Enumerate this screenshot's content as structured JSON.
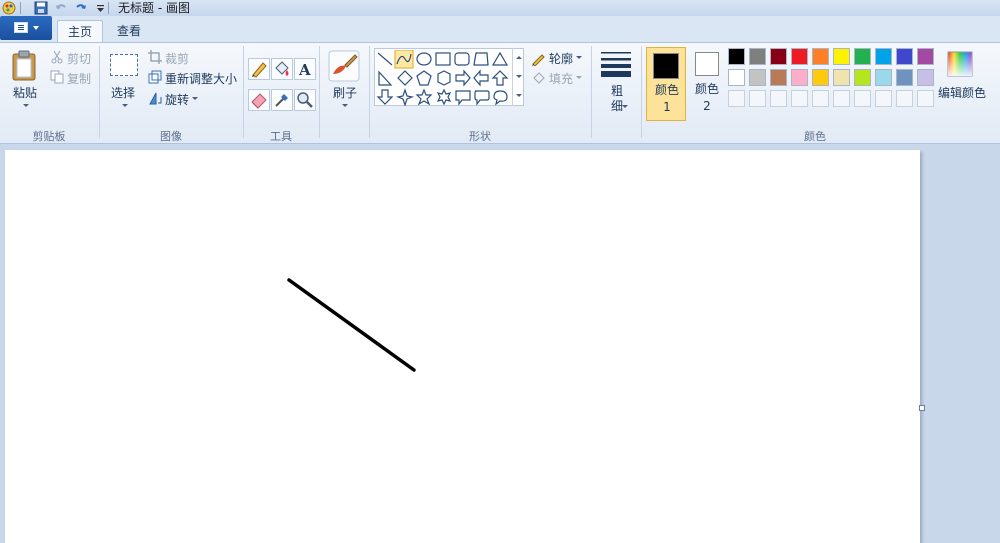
{
  "window": {
    "title": "无标题 - 画图"
  },
  "tabs": [
    {
      "label": "主页",
      "active": true
    },
    {
      "label": "查看",
      "active": false
    }
  ],
  "groups": {
    "clipboard": {
      "label": "剪贴板",
      "paste": "粘贴",
      "cut": "剪切",
      "copy": "复制"
    },
    "image": {
      "label": "图像",
      "select": "选择",
      "crop": "裁剪",
      "resize": "重新调整大小",
      "rotate": "旋转"
    },
    "tools": {
      "label": "工具"
    },
    "brushes": {
      "label": "刷子"
    },
    "shapes": {
      "label": "形状",
      "outline": "轮廓",
      "fill": "填充"
    },
    "size": {
      "label": "粗细"
    },
    "colors": {
      "label": "颜色",
      "color1_label": "颜色 1",
      "color2_label": "颜色 2",
      "edit_label": "编辑颜色",
      "color1": "#000000",
      "color2": "#ffffff",
      "palette_row1": [
        "#000000",
        "#7f7f7f",
        "#880015",
        "#ed1c24",
        "#ff7f27",
        "#fff200",
        "#22b14c",
        "#00a2e8",
        "#3f48cc",
        "#a349a4"
      ],
      "palette_row2": [
        "#ffffff",
        "#c3c3c3",
        "#b97a57",
        "#ffaec9",
        "#ffc90e",
        "#efe4b0",
        "#b5e61d",
        "#99d9ea",
        "#7092be",
        "#c8bfe7"
      ]
    }
  },
  "canvas": {
    "line_color": "#000000"
  }
}
